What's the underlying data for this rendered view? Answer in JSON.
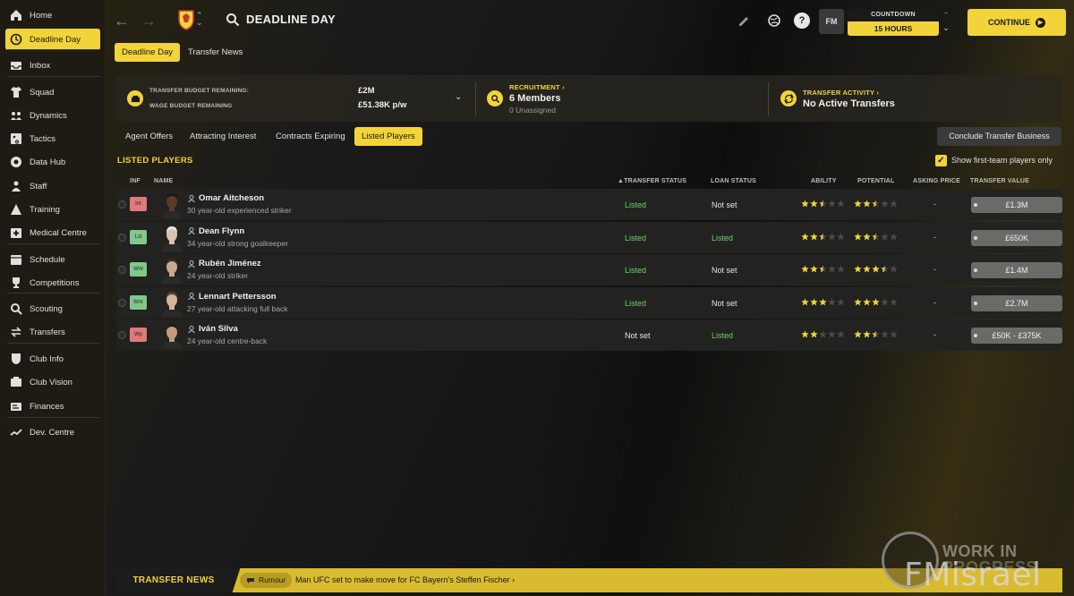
{
  "sidebar": {
    "items": [
      {
        "label": "Home",
        "icon": "home-icon"
      },
      {
        "label": "Deadline Day",
        "icon": "clock-icon",
        "active": true
      },
      {
        "label": "Inbox",
        "icon": "inbox-icon"
      },
      {
        "label": "Squad",
        "icon": "shirt-icon"
      },
      {
        "label": "Dynamics",
        "icon": "dynamics-icon"
      },
      {
        "label": "Tactics",
        "icon": "tactics-icon"
      },
      {
        "label": "Data Hub",
        "icon": "data-hub-icon"
      },
      {
        "label": "Staff",
        "icon": "staff-icon"
      },
      {
        "label": "Training",
        "icon": "training-icon"
      },
      {
        "label": "Medical Centre",
        "icon": "medical-icon"
      },
      {
        "label": "Schedule",
        "icon": "calendar-icon"
      },
      {
        "label": "Competitions",
        "icon": "trophy-icon"
      },
      {
        "label": "Scouting",
        "icon": "scouting-icon"
      },
      {
        "label": "Transfers",
        "icon": "transfers-icon"
      },
      {
        "label": "Club Info",
        "icon": "shield-icon"
      },
      {
        "label": "Club Vision",
        "icon": "vision-icon"
      },
      {
        "label": "Finances",
        "icon": "finances-icon"
      },
      {
        "label": "Dev. Centre",
        "icon": "dev-centre-icon"
      }
    ]
  },
  "header": {
    "title": "DEADLINE DAY",
    "countdown_label": "COUNTDOWN",
    "countdown_value": "15 HOURS",
    "fm_badge": "FM",
    "help_label": "?",
    "continue_label": "CONTINUE"
  },
  "subtabs": [
    "Deadline Day",
    "Transfer News"
  ],
  "info": {
    "budget_label": "TRANSFER BUDGET REMAINING:",
    "wage_label": "WAGE BUDGET REMAINING",
    "budget_value": "£2M",
    "wage_value": "£51.38K p/w",
    "recruitment_head": "RECRUITMENT",
    "recruitment_value": "6 Members",
    "recruitment_sub": "0 Unassigned",
    "activity_head": "TRANSFER ACTIVITY",
    "activity_value": "No Active Transfers"
  },
  "filter_tabs": [
    "Agent Offers",
    "Attracting Interest",
    "Contracts Expiring",
    "Listed Players"
  ],
  "conclude_label": "Conclude Transfer Business",
  "section_title": "LISTED PLAYERS",
  "show_first_team_label": "Show first-team players only",
  "columns": {
    "inf": "INF",
    "name": "NAME",
    "transfer_status": "TRANSFER STATUS",
    "loan_status": "LOAN STATUS",
    "ability": "ABILITY",
    "potential": "POTENTIAL",
    "asking_price": "ASKING PRICE",
    "transfer_value": "TRANSFER VALUE"
  },
  "players": [
    {
      "inf": "Int",
      "inf_color": "#e07a7a",
      "name": "Omar Aitcheson",
      "desc": "30 year-old experienced striker",
      "transfer_status": "Listed",
      "loan_status": "Not set",
      "ability": 2.5,
      "potential": 2.5,
      "asking": "-",
      "value": "£1.3M",
      "skin": "#5a3a2a",
      "hair": "#1a1a1a"
    },
    {
      "inf": "Lst",
      "inf_color": "#7fc98a",
      "name": "Dean Flynn",
      "desc": "34 year-old strong goalkeeper",
      "transfer_status": "Listed",
      "loan_status": "Listed",
      "ability": 2.5,
      "potential": 2.5,
      "asking": "-",
      "value": "£650K",
      "skin": "#d9c2b0",
      "hair": "#e6e6e6"
    },
    {
      "inf": "Wnt",
      "inf_color": "#7fc98a",
      "name": "Rubén Jiménez",
      "desc": "24 year-old striker",
      "transfer_status": "Listed",
      "loan_status": "Not set",
      "ability": 2.5,
      "potential": 3.5,
      "asking": "-",
      "value": "£1.4M",
      "skin": "#c9a88e",
      "hair": "#3a2a20"
    },
    {
      "inf": "Wnt",
      "inf_color": "#7fc98a",
      "name": "Lennart Pettersson",
      "desc": "27 year-old attacking full back",
      "transfer_status": "Listed",
      "loan_status": "Not set",
      "ability": 3,
      "potential": 3,
      "asking": "-",
      "value": "£2.7M",
      "skin": "#d4b39a",
      "hair": "#5a4030"
    },
    {
      "inf": "Wp",
      "inf_color": "#e07a7a",
      "name": "Iván Silva",
      "desc": "24 year-old centre-back",
      "transfer_status": "Not set",
      "loan_status": "Listed",
      "ability": 2,
      "potential": 2.5,
      "asking": "-",
      "value": "£50K - £375K",
      "skin": "#c29a7e",
      "hair": "#1a1a1a"
    }
  ],
  "news": {
    "label": "TRANSFER NEWS",
    "tag": "Rumour",
    "headline": "Man UFC set to make move for FC Bayern's Steffen Fischer"
  },
  "watermark": {
    "line1": "WORK IN",
    "line2": "PROGRESS",
    "brand": "FMisrael"
  },
  "colors": {
    "accent": "#f2d33a",
    "listed_green": "#6ed36e"
  }
}
